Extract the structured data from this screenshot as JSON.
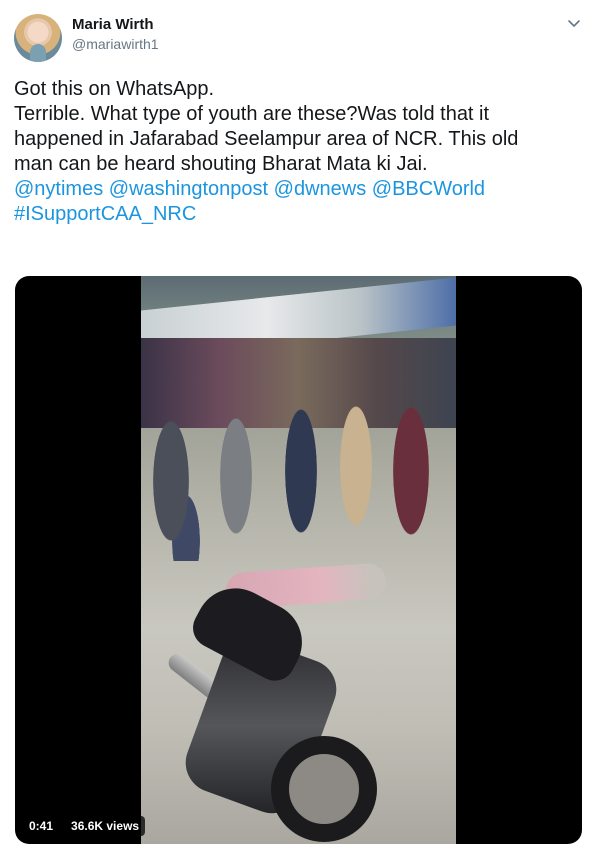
{
  "author": {
    "name": "Maria Wirth",
    "handle": "@mariawirth1"
  },
  "tweet": {
    "lines": [
      "Got this on WhatsApp.",
      "Terrible. What type of youth are these?Was told that it",
      "happened in Jafarabad Seelampur area of NCR. This old",
      "man can be heard shouting Bharat Mata ki Jai."
    ],
    "mentions": [
      "@nytimes",
      "@washingtonpost",
      "@dwnews",
      "@BBCWorld"
    ],
    "hashtag": "#ISupportCAA_NRC"
  },
  "media": {
    "duration": "0:41",
    "views": "36.6K views"
  },
  "icons": {
    "menu": "chevron-down-icon",
    "avatar": "avatar"
  },
  "colors": {
    "link": "#1b95e0",
    "text": "#14171a",
    "secondary": "#657786"
  }
}
